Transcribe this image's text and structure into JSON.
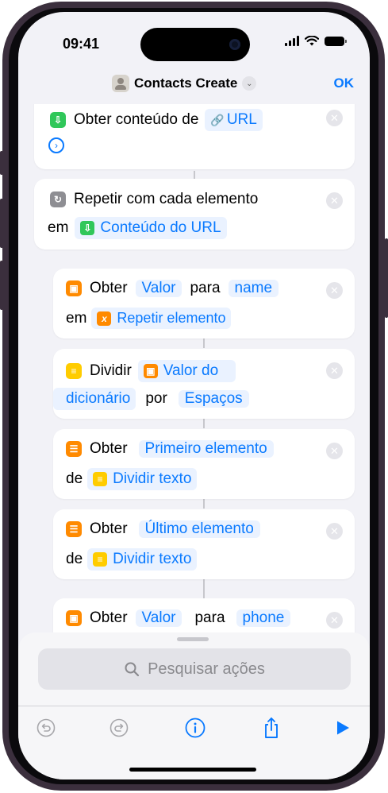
{
  "status": {
    "time": "09:41"
  },
  "header": {
    "title": "Contacts Create",
    "ok": "OK"
  },
  "actions": [
    {
      "line1_prefix": "Obter conteúdo de",
      "chip_url": "URL"
    },
    {
      "line1": "Repetir com cada elemento",
      "line2_prefix": "em",
      "chip": "Conteúdo do URL"
    },
    {
      "verb": "Obter",
      "chip_a": "Valor",
      "mid": "para",
      "chip_b": "name",
      "line2_prefix": "em",
      "chip_c": "Repetir elemento"
    },
    {
      "verb": "Dividir",
      "chip_a_1": "Valor do",
      "chip_a_2": "dicionário",
      "mid": "por",
      "chip_b": "Espaços"
    },
    {
      "verb": "Obter",
      "chip_a": "Primeiro elemento",
      "line2_prefix": "de",
      "chip_b": "Dividir texto"
    },
    {
      "verb": "Obter",
      "chip_a": "Último elemento",
      "line2_prefix": "de",
      "chip_b": "Dividir texto"
    },
    {
      "verb": "Obter",
      "chip_a": "Valor",
      "mid": "para",
      "chip_b": "phone"
    }
  ],
  "sheet": {
    "search_placeholder": "Pesquisar ações"
  },
  "colors": {
    "accent": "#0a7aff",
    "green": "#30c75a",
    "orange": "#ff8a00",
    "yellow": "#ffcc00"
  },
  "toolbar_icons": [
    "undo-icon",
    "redo-icon",
    "info-icon",
    "share-icon",
    "play-icon"
  ]
}
